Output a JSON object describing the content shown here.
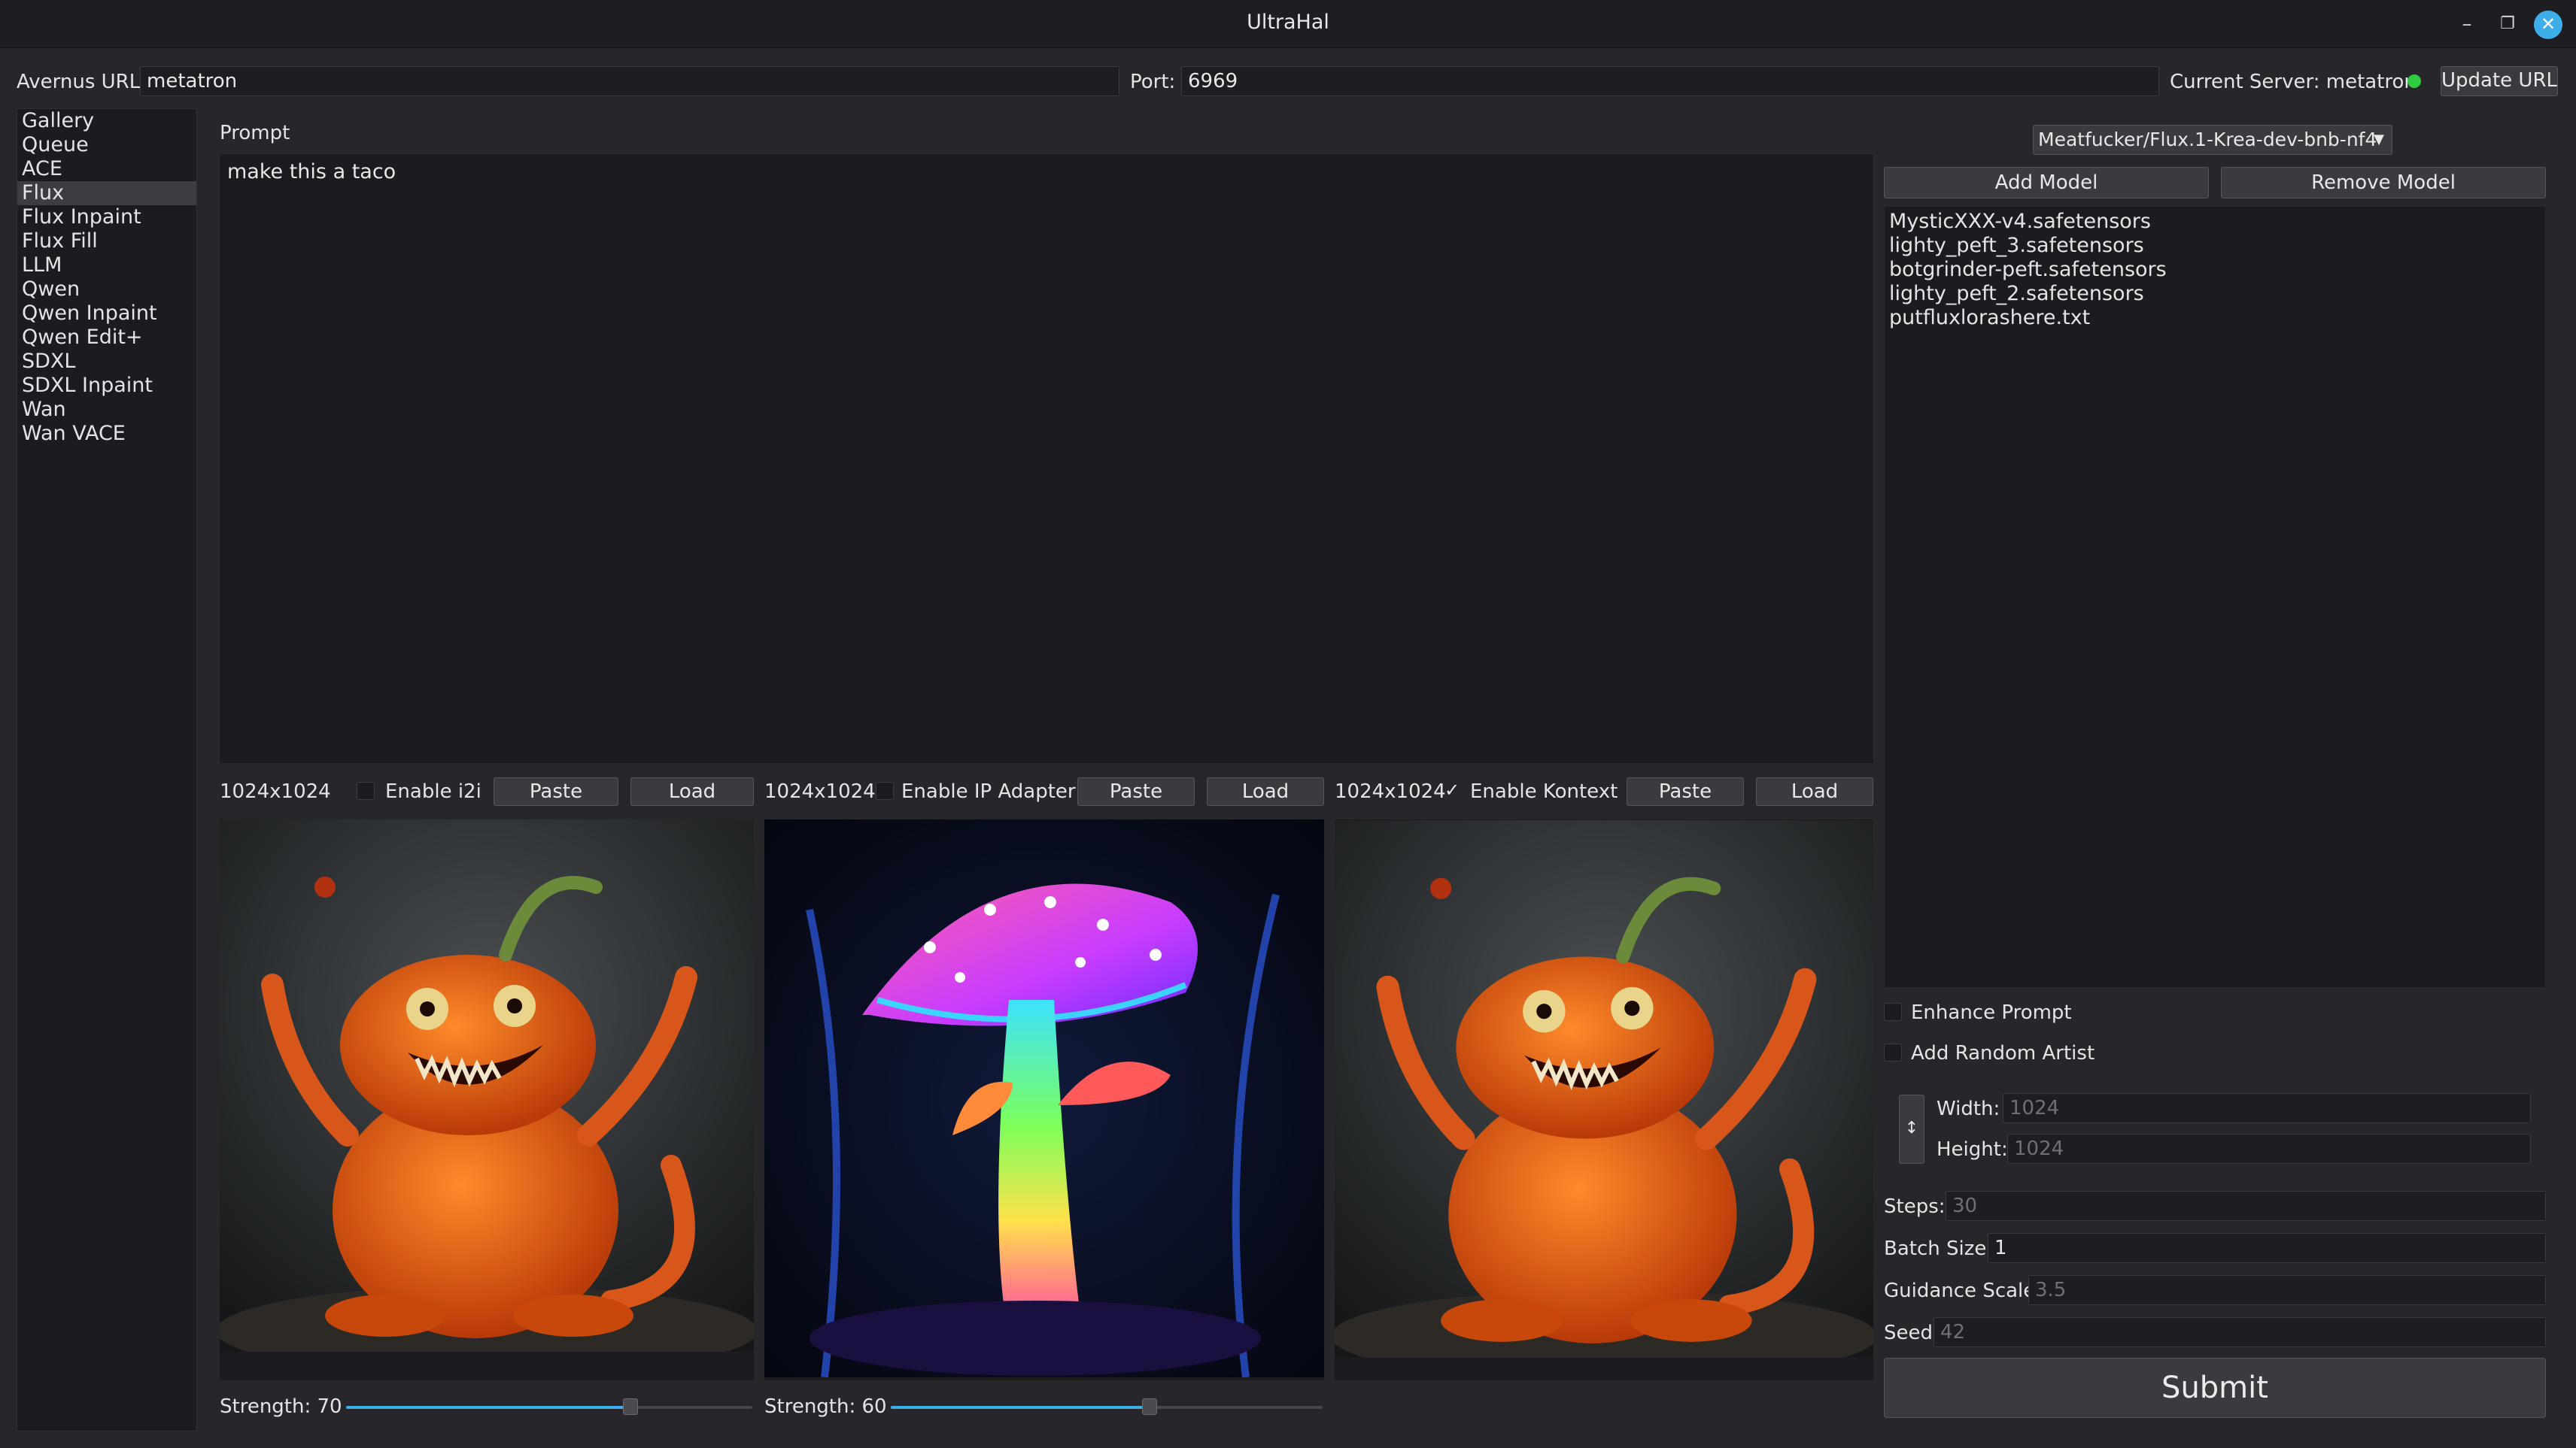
{
  "window": {
    "title": "UltraHal"
  },
  "server": {
    "url_label": "Avernus URL:",
    "url_value": "metatron",
    "port_label": "Port:",
    "port_value": "6969",
    "current_label": "Current Server: metatron",
    "status_color": "#2ecc40",
    "update_button": "Update URL"
  },
  "sidebar": {
    "items": [
      {
        "label": "Gallery"
      },
      {
        "label": "Queue"
      },
      {
        "label": "ACE"
      },
      {
        "label": "Flux"
      },
      {
        "label": "Flux Inpaint"
      },
      {
        "label": "Flux Fill"
      },
      {
        "label": "LLM"
      },
      {
        "label": "Qwen"
      },
      {
        "label": "Qwen Inpaint"
      },
      {
        "label": "Qwen Edit+"
      },
      {
        "label": "SDXL"
      },
      {
        "label": "SDXL Inpaint"
      },
      {
        "label": "Wan"
      },
      {
        "label": "Wan VACE"
      }
    ],
    "active": "Flux"
  },
  "prompt": {
    "label": "Prompt",
    "text": "make this a taco"
  },
  "panels": [
    {
      "size": "1024x1024",
      "enable_label": "Enable i2i",
      "checked": false,
      "paste": "Paste",
      "load": "Load",
      "image": "orange-creature-icon",
      "strength_label": "Strength:",
      "strength": "70",
      "strength_pct": 0.7
    },
    {
      "size": "1024x1024",
      "enable_label": "Enable IP Adapter",
      "checked": false,
      "paste": "Paste",
      "load": "Load",
      "image": "neon-mushroom-icon",
      "strength_label": "Strength:",
      "strength": "60",
      "strength_pct": 0.6
    },
    {
      "size": "1024x1024",
      "enable_label": "Enable Kontext",
      "checked": true,
      "paste": "Paste",
      "load": "Load",
      "image": "orange-creature-icon"
    }
  ],
  "model": {
    "selected": "Meatfucker/Flux.1-Krea-dev-bnb-nf4",
    "add": "Add Model",
    "remove": "Remove Model",
    "loras": [
      {
        "label": "MysticXXX-v4.safetensors"
      },
      {
        "label": "lighty_peft_3.safetensors"
      },
      {
        "label": "botgrinder-peft.safetensors"
      },
      {
        "label": "lighty_peft_2.safetensors"
      },
      {
        "label": "putfluxlorashere.txt"
      }
    ]
  },
  "options": {
    "enhance_prompt": "Enhance Prompt",
    "add_random_artist": "Add Random Artist",
    "width_label": "Width:",
    "width_placeholder": "1024",
    "height_label": "Height:",
    "height_placeholder": "1024",
    "steps_label": "Steps:",
    "steps_placeholder": "30",
    "batch_label": "Batch Size:",
    "batch_value": "1",
    "guidance_label": "Guidance Scale:",
    "guidance_placeholder": "3.5",
    "seed_label": "Seed",
    "seed_placeholder": "42",
    "submit": "Submit"
  },
  "colors": {
    "accent": "#3daee9",
    "background": "#27272b",
    "field": "#1c1c20"
  }
}
